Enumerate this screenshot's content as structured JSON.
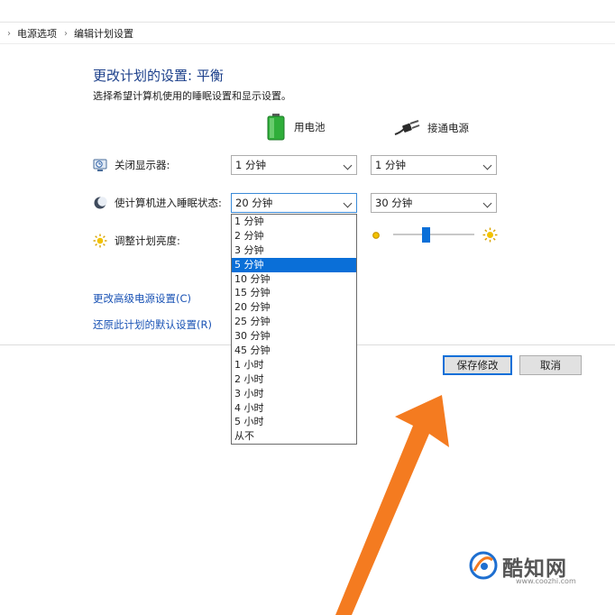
{
  "breadcrumb": {
    "items": [
      "电源选项",
      "编辑计划设置"
    ]
  },
  "page": {
    "title": "更改计划的设置: 平衡",
    "subtitle": "选择希望计算机使用的睡眠设置和显示设置。"
  },
  "columns": {
    "battery": "用电池",
    "plugged": "接通电源"
  },
  "rows": {
    "display_off": {
      "label": "关闭显示器:",
      "battery_value": "1 分钟",
      "plugged_value": "1 分钟"
    },
    "sleep": {
      "label": "使计算机进入睡眠状态:",
      "battery_value": "20 分钟",
      "plugged_value": "30 分钟"
    },
    "brightness": {
      "label": "调整计划亮度:",
      "plugged_level_percent": 40
    }
  },
  "dropdown": {
    "options": [
      "1 分钟",
      "2 分钟",
      "3 分钟",
      "5 分钟",
      "10 分钟",
      "15 分钟",
      "20 分钟",
      "25 分钟",
      "30 分钟",
      "45 分钟",
      "1 小时",
      "2 小时",
      "3 小时",
      "4 小时",
      "5 小时",
      "从不"
    ],
    "highlighted_index": 3
  },
  "links": {
    "advanced": "更改高级电源设置(C)",
    "restore": "还原此计划的默认设置(R)"
  },
  "buttons": {
    "save": "保存修改",
    "cancel": "取消"
  },
  "watermark": {
    "brand": "酷知网",
    "url": "www.coozhi.com"
  },
  "colors": {
    "accent": "#0a6fd8",
    "title": "#1a3e8a",
    "link": "#1a53b5",
    "arrow": "#f47b20",
    "battery": "#2fae3a"
  }
}
